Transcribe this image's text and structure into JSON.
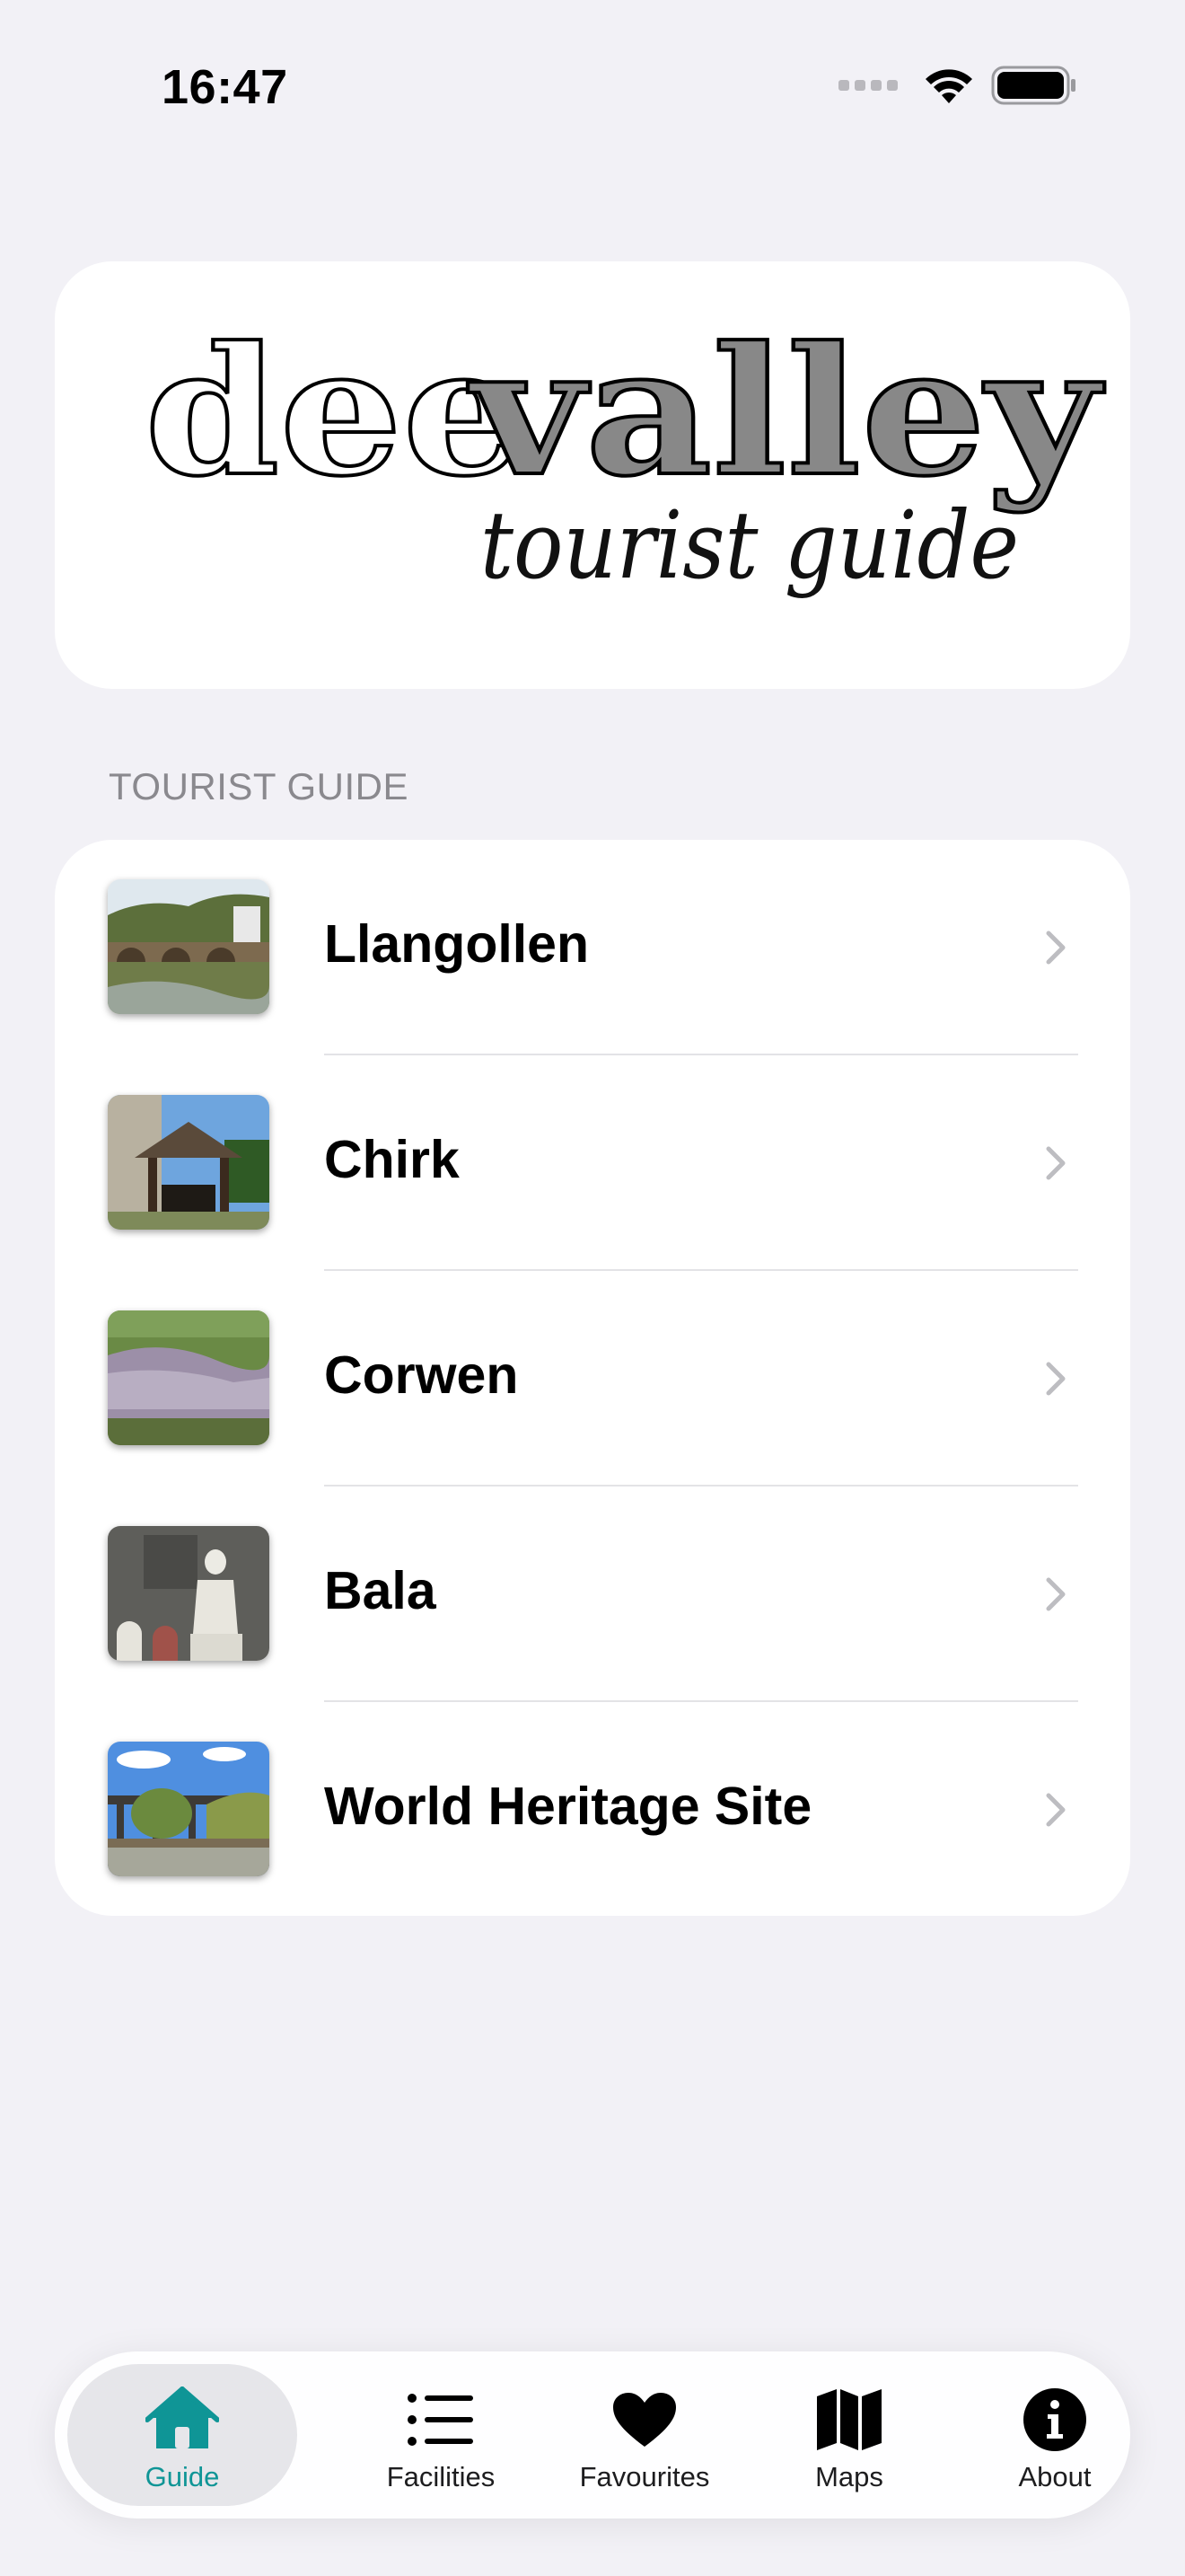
{
  "status_bar": {
    "time": "16:47"
  },
  "logo": {
    "word_dee": "dee",
    "word_valley": "valley",
    "subtitle": "tourist guide"
  },
  "section": {
    "header": "TOURIST GUIDE"
  },
  "guide_items": [
    {
      "label": "Llangollen",
      "thumbnail": "bridge-over-river-photo"
    },
    {
      "label": "Chirk",
      "thumbnail": "church-lychgate-photo"
    },
    {
      "label": "Corwen",
      "thumbnail": "town-in-valley-photo"
    },
    {
      "label": "Bala",
      "thumbnail": "statue-photo"
    },
    {
      "label": "World Heritage Site",
      "thumbnail": "aqueduct-photo"
    }
  ],
  "tab_bar": {
    "tabs": [
      {
        "label": "Guide",
        "icon": "house-icon",
        "active": true
      },
      {
        "label": "Facilities",
        "icon": "list-icon",
        "active": false
      },
      {
        "label": "Favourites",
        "icon": "heart-icon",
        "active": false
      },
      {
        "label": "Maps",
        "icon": "map-icon",
        "active": false
      },
      {
        "label": "About",
        "icon": "info-icon",
        "active": false
      }
    ]
  },
  "colors": {
    "accent": "#0f9596",
    "background": "#f2f1f6",
    "logo_fill": "#888888"
  }
}
